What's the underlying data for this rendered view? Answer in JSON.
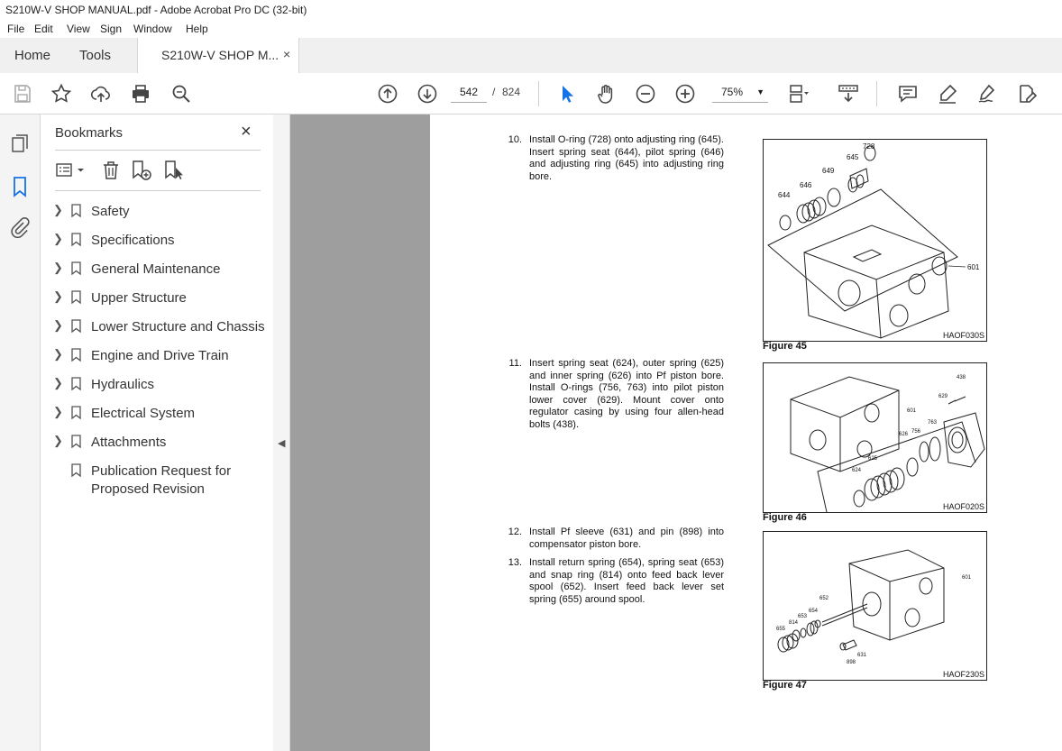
{
  "window": {
    "title": "S210W-V SHOP MANUAL.pdf - Adobe Acrobat Pro DC (32-bit)"
  },
  "menu": [
    "File",
    "Edit",
    "View",
    "Sign",
    "Window",
    "Help"
  ],
  "tabs": {
    "home": "Home",
    "tools": "Tools",
    "document": "S210W-V SHOP M...",
    "close_glyph": "×"
  },
  "toolbar": {
    "page_current": "542",
    "page_separator": "/",
    "page_total": "824",
    "zoom": "75%",
    "icons": [
      "save-icon",
      "bookmark-star-icon",
      "upload-icon",
      "print-icon",
      "find-icon",
      "prev-page-icon",
      "next-page-icon",
      "select-arrow-icon",
      "hand-icon",
      "zoom-out-icon",
      "zoom-in-icon",
      "page-layout-icon",
      "scroll-mode-icon",
      "comment-icon",
      "highlight-icon",
      "sign-icon",
      "edit-pdf-icon"
    ]
  },
  "sidebar": {
    "title": "Bookmarks",
    "close_glyph": "×",
    "items": [
      {
        "label": "Safety",
        "expandable": true
      },
      {
        "label": "Specifications",
        "expandable": true
      },
      {
        "label": "General Maintenance",
        "expandable": true
      },
      {
        "label": "Upper Structure",
        "expandable": true
      },
      {
        "label": "Lower Structure and Chassis",
        "expandable": true
      },
      {
        "label": "Engine and Drive Train",
        "expandable": true
      },
      {
        "label": "Hydraulics",
        "expandable": true
      },
      {
        "label": "Electrical System",
        "expandable": true
      },
      {
        "label": "Attachments",
        "expandable": true
      },
      {
        "label": "Publication Request for Proposed Revision",
        "label_line1": "Publication Request for",
        "label_line2": "Proposed Revision",
        "expandable": false
      }
    ]
  },
  "document": {
    "steps": [
      {
        "num": "10.",
        "text": "Install O-ring (728) onto adjusting ring (645). Insert spring seat (644), pilot spring (646) and adjusting ring (645) into adjusting ring bore."
      },
      {
        "num": "11.",
        "text": "Insert spring seat (624), outer spring (625) and inner spring (626) into Pf piston bore. Install O-rings (756, 763) into pilot piston lower cover (629). Mount cover onto regulator casing by using four allen-head bolts (438)."
      },
      {
        "num": "12.",
        "text": "Install Pf sleeve (631) and pin (898) into compensator piston bore."
      },
      {
        "num": "13.",
        "text": "Install return spring (654), spring seat (653) and snap ring (814) onto feed back lever spool (652). Insert feed back lever set spring (655) around spool."
      }
    ],
    "figures": [
      {
        "caption": "Figure 45",
        "code": "HAOF030S",
        "callouts": [
          "728",
          "645",
          "649",
          "646",
          "644",
          "601"
        ]
      },
      {
        "caption": "Figure 46",
        "code": "HAOF020S",
        "callouts": [
          "438",
          "629",
          "601",
          "763",
          "626",
          "756",
          "625",
          "624"
        ]
      },
      {
        "caption": "Figure 47",
        "code": "HAOF230S",
        "callouts": [
          "601",
          "652",
          "654",
          "653",
          "814",
          "655",
          "631",
          "898"
        ]
      }
    ]
  }
}
